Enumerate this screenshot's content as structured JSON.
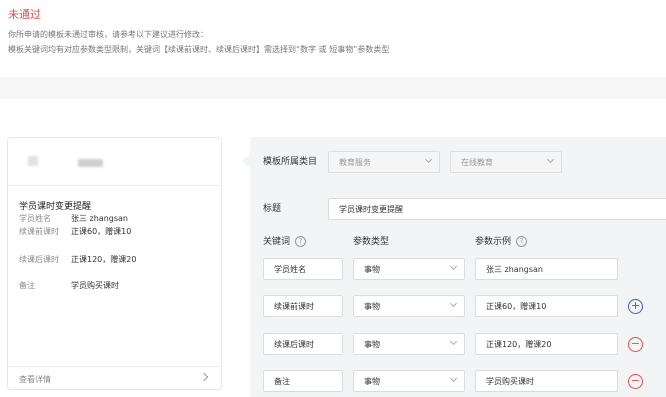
{
  "notice": {
    "status": "未通过",
    "line1": "你所申请的模板未通过审核，请参考以下建议进行修改：",
    "line2": "模板关键词均有对应参数类型限制，关键词【续课前课时、续课后课时】需选择到“数字 或 短事物”参数类型"
  },
  "preview": {
    "title": "学员课时变更提醒",
    "rows": [
      {
        "key": "学员姓名",
        "value": "张三 zhangsan"
      },
      {
        "key": "续课前课时",
        "value": "正课60，赠课10"
      },
      {
        "key": "续课后课时",
        "value": "正课120，赠课20"
      },
      {
        "key": "备注",
        "value": "学员购买课时"
      }
    ],
    "footer_label": "查看详情"
  },
  "form": {
    "category_label": "模板所属类目",
    "category_primary": "教育服务",
    "category_secondary": "在线教育",
    "title_label": "标题",
    "title_value": "学员课时变更提醒",
    "keyword_header": "关键词",
    "param_type_header": "参数类型",
    "param_example_header": "参数示例",
    "help_glyph": "?",
    "add_glyph": "+",
    "remove_glyph": "−",
    "rows": [
      {
        "keyword": "学员姓名",
        "type": "事物",
        "example": "张三 zhangsan"
      },
      {
        "keyword": "续课前课时",
        "type": "事物",
        "example": "正课60，赠课10"
      },
      {
        "keyword": "续课后课时",
        "type": "事物",
        "example": "正课120，赠课20"
      },
      {
        "keyword": "备注",
        "type": "事物",
        "example": "学员购买课时"
      }
    ]
  }
}
